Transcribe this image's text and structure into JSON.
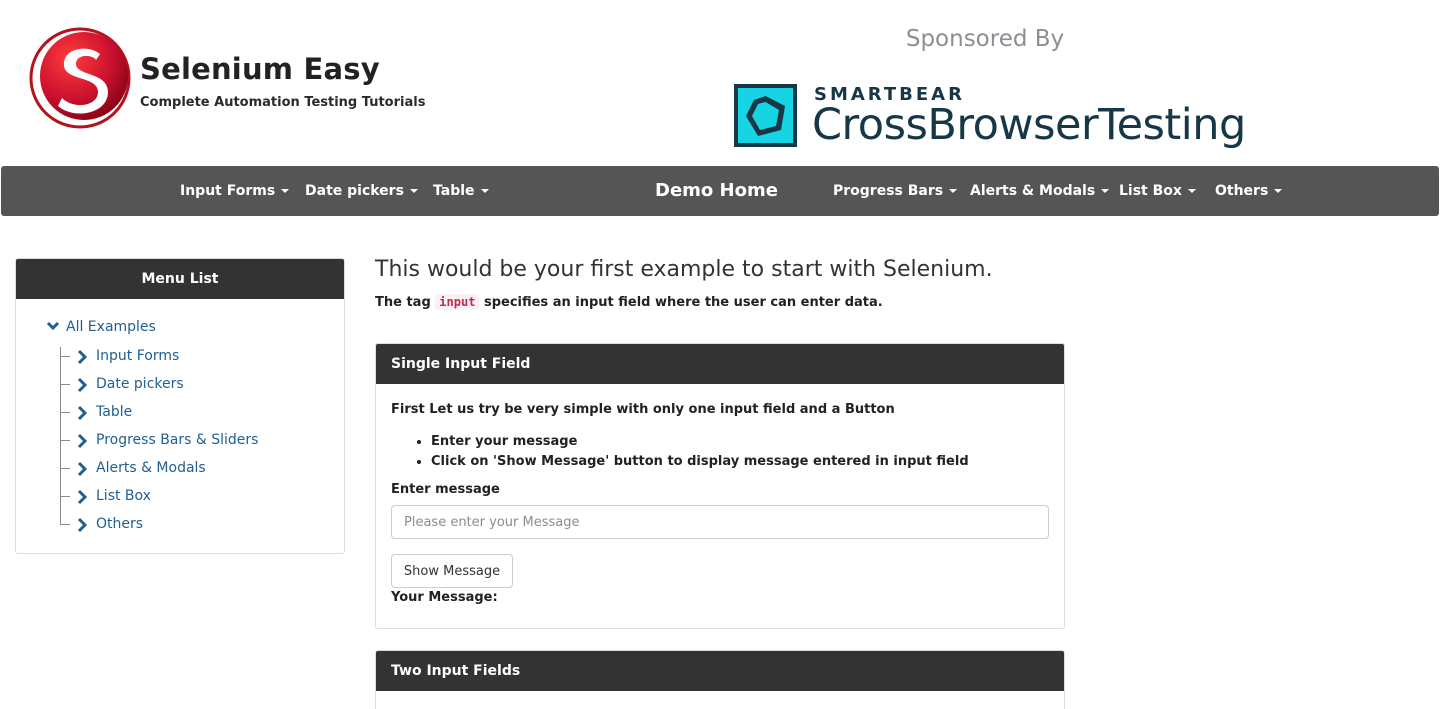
{
  "header": {
    "logo_title": "Selenium Easy",
    "logo_tagline": "Complete Automation Testing Tutorials",
    "sponsor_label": "Sponsored By",
    "sponsor_brand_top": "SMARTBEAR",
    "sponsor_brand_main": "CrossBrowserTesting"
  },
  "navbar": {
    "brand": "Demo Home",
    "left_items": [
      "Input Forms",
      "Date pickers",
      "Table"
    ],
    "right_items": [
      "Progress Bars",
      "Alerts & Modals",
      "List Box",
      "Others"
    ]
  },
  "sidebar": {
    "title": "Menu List",
    "root": "All Examples",
    "items": [
      "Input Forms",
      "Date pickers",
      "Table",
      "Progress Bars & Sliders",
      "Alerts & Modals",
      "List Box",
      "Others"
    ]
  },
  "main": {
    "title": "This would be your first example to start with Selenium.",
    "desc_prefix": "The tag",
    "desc_code": "input",
    "desc_suffix": "specifies an input field where the user can enter data."
  },
  "panel_single": {
    "heading": "Single Input Field",
    "intro": "First Let us try be very simple with only one input field and a Button",
    "bullets": [
      "Enter your message",
      "Click on 'Show Message' button to display message entered in input field"
    ],
    "input_label": "Enter message",
    "input_value": "",
    "input_placeholder": "Please enter your Message",
    "button_label": "Show Message",
    "result_label": "Your Message:"
  },
  "panel_two": {
    "heading": "Two Input Fields"
  },
  "colors": {
    "navbar_bg": "#555555",
    "panel_head_bg": "#333333",
    "link": "#1f5f93",
    "logo_red": "#c8102e",
    "smartbear_cyan": "#17d4e4",
    "smartbear_navy": "#173746"
  }
}
